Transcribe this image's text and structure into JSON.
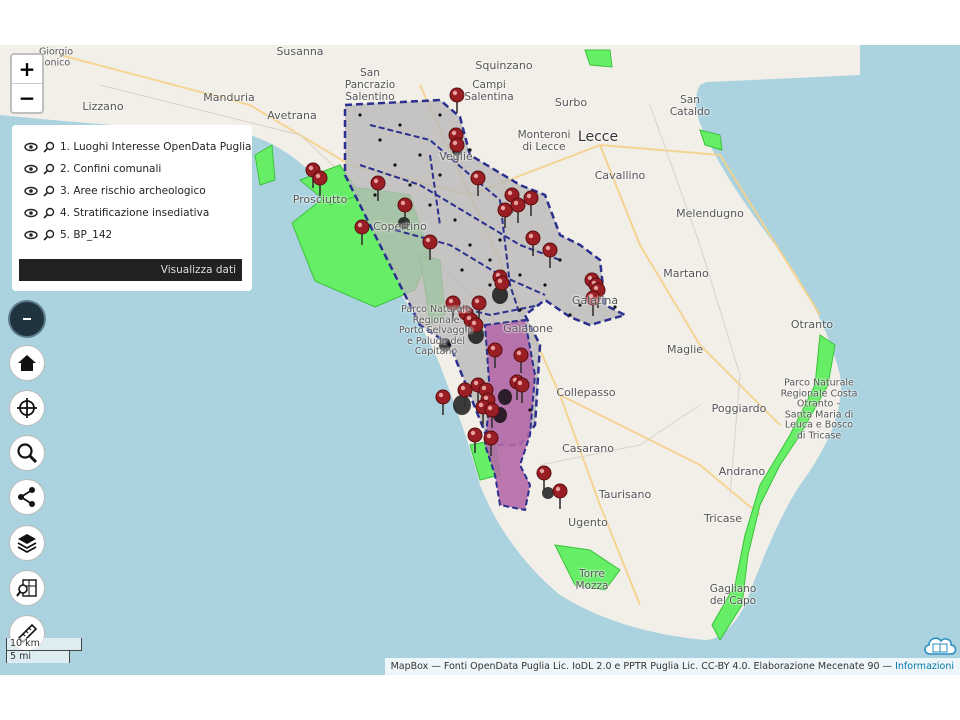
{
  "map": {
    "zoom_in": "+",
    "zoom_out": "−",
    "places": [
      {
        "name": "Giorgio\nIonico",
        "key": "giorgio"
      },
      {
        "name": "Susanna",
        "key": "susanna"
      },
      {
        "name": "Squinzano",
        "key": "squinzano"
      },
      {
        "name": "San\nPancrazio\nSalentino",
        "key": "pancrazio"
      },
      {
        "name": "Campi\nSalentina",
        "key": "campi"
      },
      {
        "name": "Surbo",
        "key": "surbo"
      },
      {
        "name": "San\nCataldo",
        "key": "cataldo"
      },
      {
        "name": "Lizzano",
        "key": "lizzano"
      },
      {
        "name": "Manduria",
        "key": "manduria"
      },
      {
        "name": "Avetrana",
        "key": "avetrana"
      },
      {
        "name": "Lecce",
        "key": "lecce"
      },
      {
        "name": "Veglie",
        "key": "veglie"
      },
      {
        "name": "Monteroni\ndi Lecce",
        "key": "monteroni"
      },
      {
        "name": "Cavallino",
        "key": "cavallino"
      },
      {
        "name": "Prosciutto",
        "key": "prosciutto"
      },
      {
        "name": "Copertino",
        "key": "copertino"
      },
      {
        "name": "Melendugno",
        "key": "melendugno"
      },
      {
        "name": "Galatina",
        "key": "galatina"
      },
      {
        "name": "Martano",
        "key": "martano"
      },
      {
        "name": "Parco Naturale\nRegionale\nPorto Selvaggio\ne Palude del\nCapitano",
        "key": "parco1"
      },
      {
        "name": "Galatone",
        "key": "galatone"
      },
      {
        "name": "Otranto",
        "key": "otranto"
      },
      {
        "name": "Maglie",
        "key": "maglie"
      },
      {
        "name": "Parco Naturale\nRegionale Costa\nOtranto –\nSanta Maria di\nLeuca e Bosco\ndi Tricase",
        "key": "parco2"
      },
      {
        "name": "Collepasso",
        "key": "collepasso"
      },
      {
        "name": "Poggiardo",
        "key": "poggiardo"
      },
      {
        "name": "Casarano",
        "key": "casarano"
      },
      {
        "name": "Andrano",
        "key": "andrano"
      },
      {
        "name": "Taurisano",
        "key": "taurisano"
      },
      {
        "name": "Ugento",
        "key": "ugento"
      },
      {
        "name": "Tricase",
        "key": "tricase"
      },
      {
        "name": "Torre\nMozza",
        "key": "torremozza"
      },
      {
        "name": "Gagliano\ndel Capo",
        "key": "gagliano"
      }
    ]
  },
  "layers_panel": {
    "items": [
      {
        "label": "1. Luoghi Interesse OpenData Puglia"
      },
      {
        "label": "2. Confini comunali"
      },
      {
        "label": "3. Aree rischio archeologico"
      },
      {
        "label": "4. Stratificazione insediativa"
      },
      {
        "label": "5. BP_142"
      }
    ],
    "button": "Visualizza dati"
  },
  "tools": [
    {
      "name": "collapse-button",
      "icon": "minus-icon"
    },
    {
      "name": "home-button",
      "icon": "home-icon"
    },
    {
      "name": "locate-button",
      "icon": "crosshair-icon"
    },
    {
      "name": "search-button",
      "icon": "search-icon"
    },
    {
      "name": "share-button",
      "icon": "share-icon"
    },
    {
      "name": "layers-button",
      "icon": "layers-icon"
    },
    {
      "name": "map-search-button",
      "icon": "map-search-icon"
    },
    {
      "name": "measure-button",
      "icon": "ruler-icon"
    }
  ],
  "scale": {
    "km": "10 km",
    "mi": "5 mi"
  },
  "attribution": {
    "text": "MapBox — Fonti OpenData Puglia Lic. IoDL 2.0 e PPTR Puglia Lic. CC-BY 4.0. Elaborazione Mecenate 90 — ",
    "link": "Informazioni"
  },
  "colors": {
    "sea": "#aad3df",
    "land": "#f2efe9",
    "protected": "#66ee66",
    "study_area": "#b9b9b9",
    "archaeo": "#b46aa9",
    "border": "#2b2f8e",
    "pin": "#9a1f24"
  }
}
